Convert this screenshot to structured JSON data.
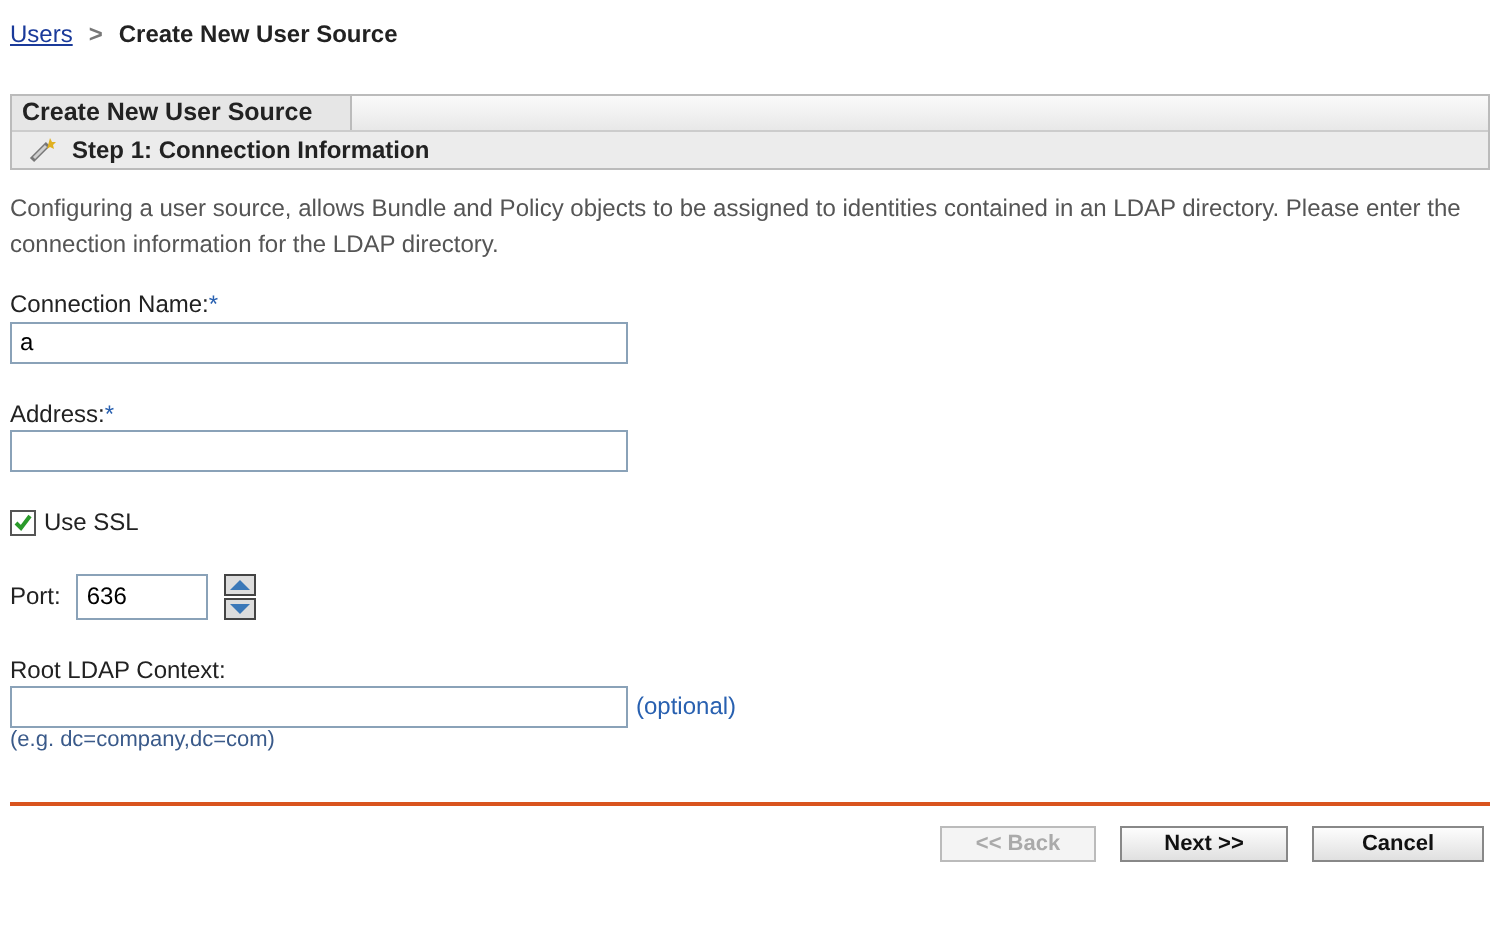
{
  "breadcrumb": {
    "link": "Users",
    "separator": ">",
    "current": "Create New User Source"
  },
  "panel": {
    "tab": "Create New User Source",
    "step": "Step 1: Connection Information"
  },
  "description": "Configuring a user source, allows Bundle and Policy objects to be assigned to identities contained in an LDAP directory. Please enter the connection information for the LDAP directory.",
  "fields": [
    {
      "kind": "text",
      "label": "Connection Name:",
      "required_mark": "*",
      "value": "a"
    },
    {
      "kind": "text",
      "label": "Address:",
      "required_mark": "*"
    },
    {
      "kind": "checkbox",
      "label": "Use SSL",
      "checked": true
    },
    {
      "kind": "spinner",
      "label": "Port:",
      "value": "636"
    },
    {
      "kind": "text",
      "label": "Root LDAP Context:",
      "note": "(optional)",
      "hint": "(e.g. dc=company,dc=com)"
    }
  ],
  "buttons": [
    {
      "label": "<< Back",
      "disabled": true
    },
    {
      "label": "Next >>",
      "disabled": false
    },
    {
      "label": "Cancel",
      "disabled": false
    }
  ]
}
